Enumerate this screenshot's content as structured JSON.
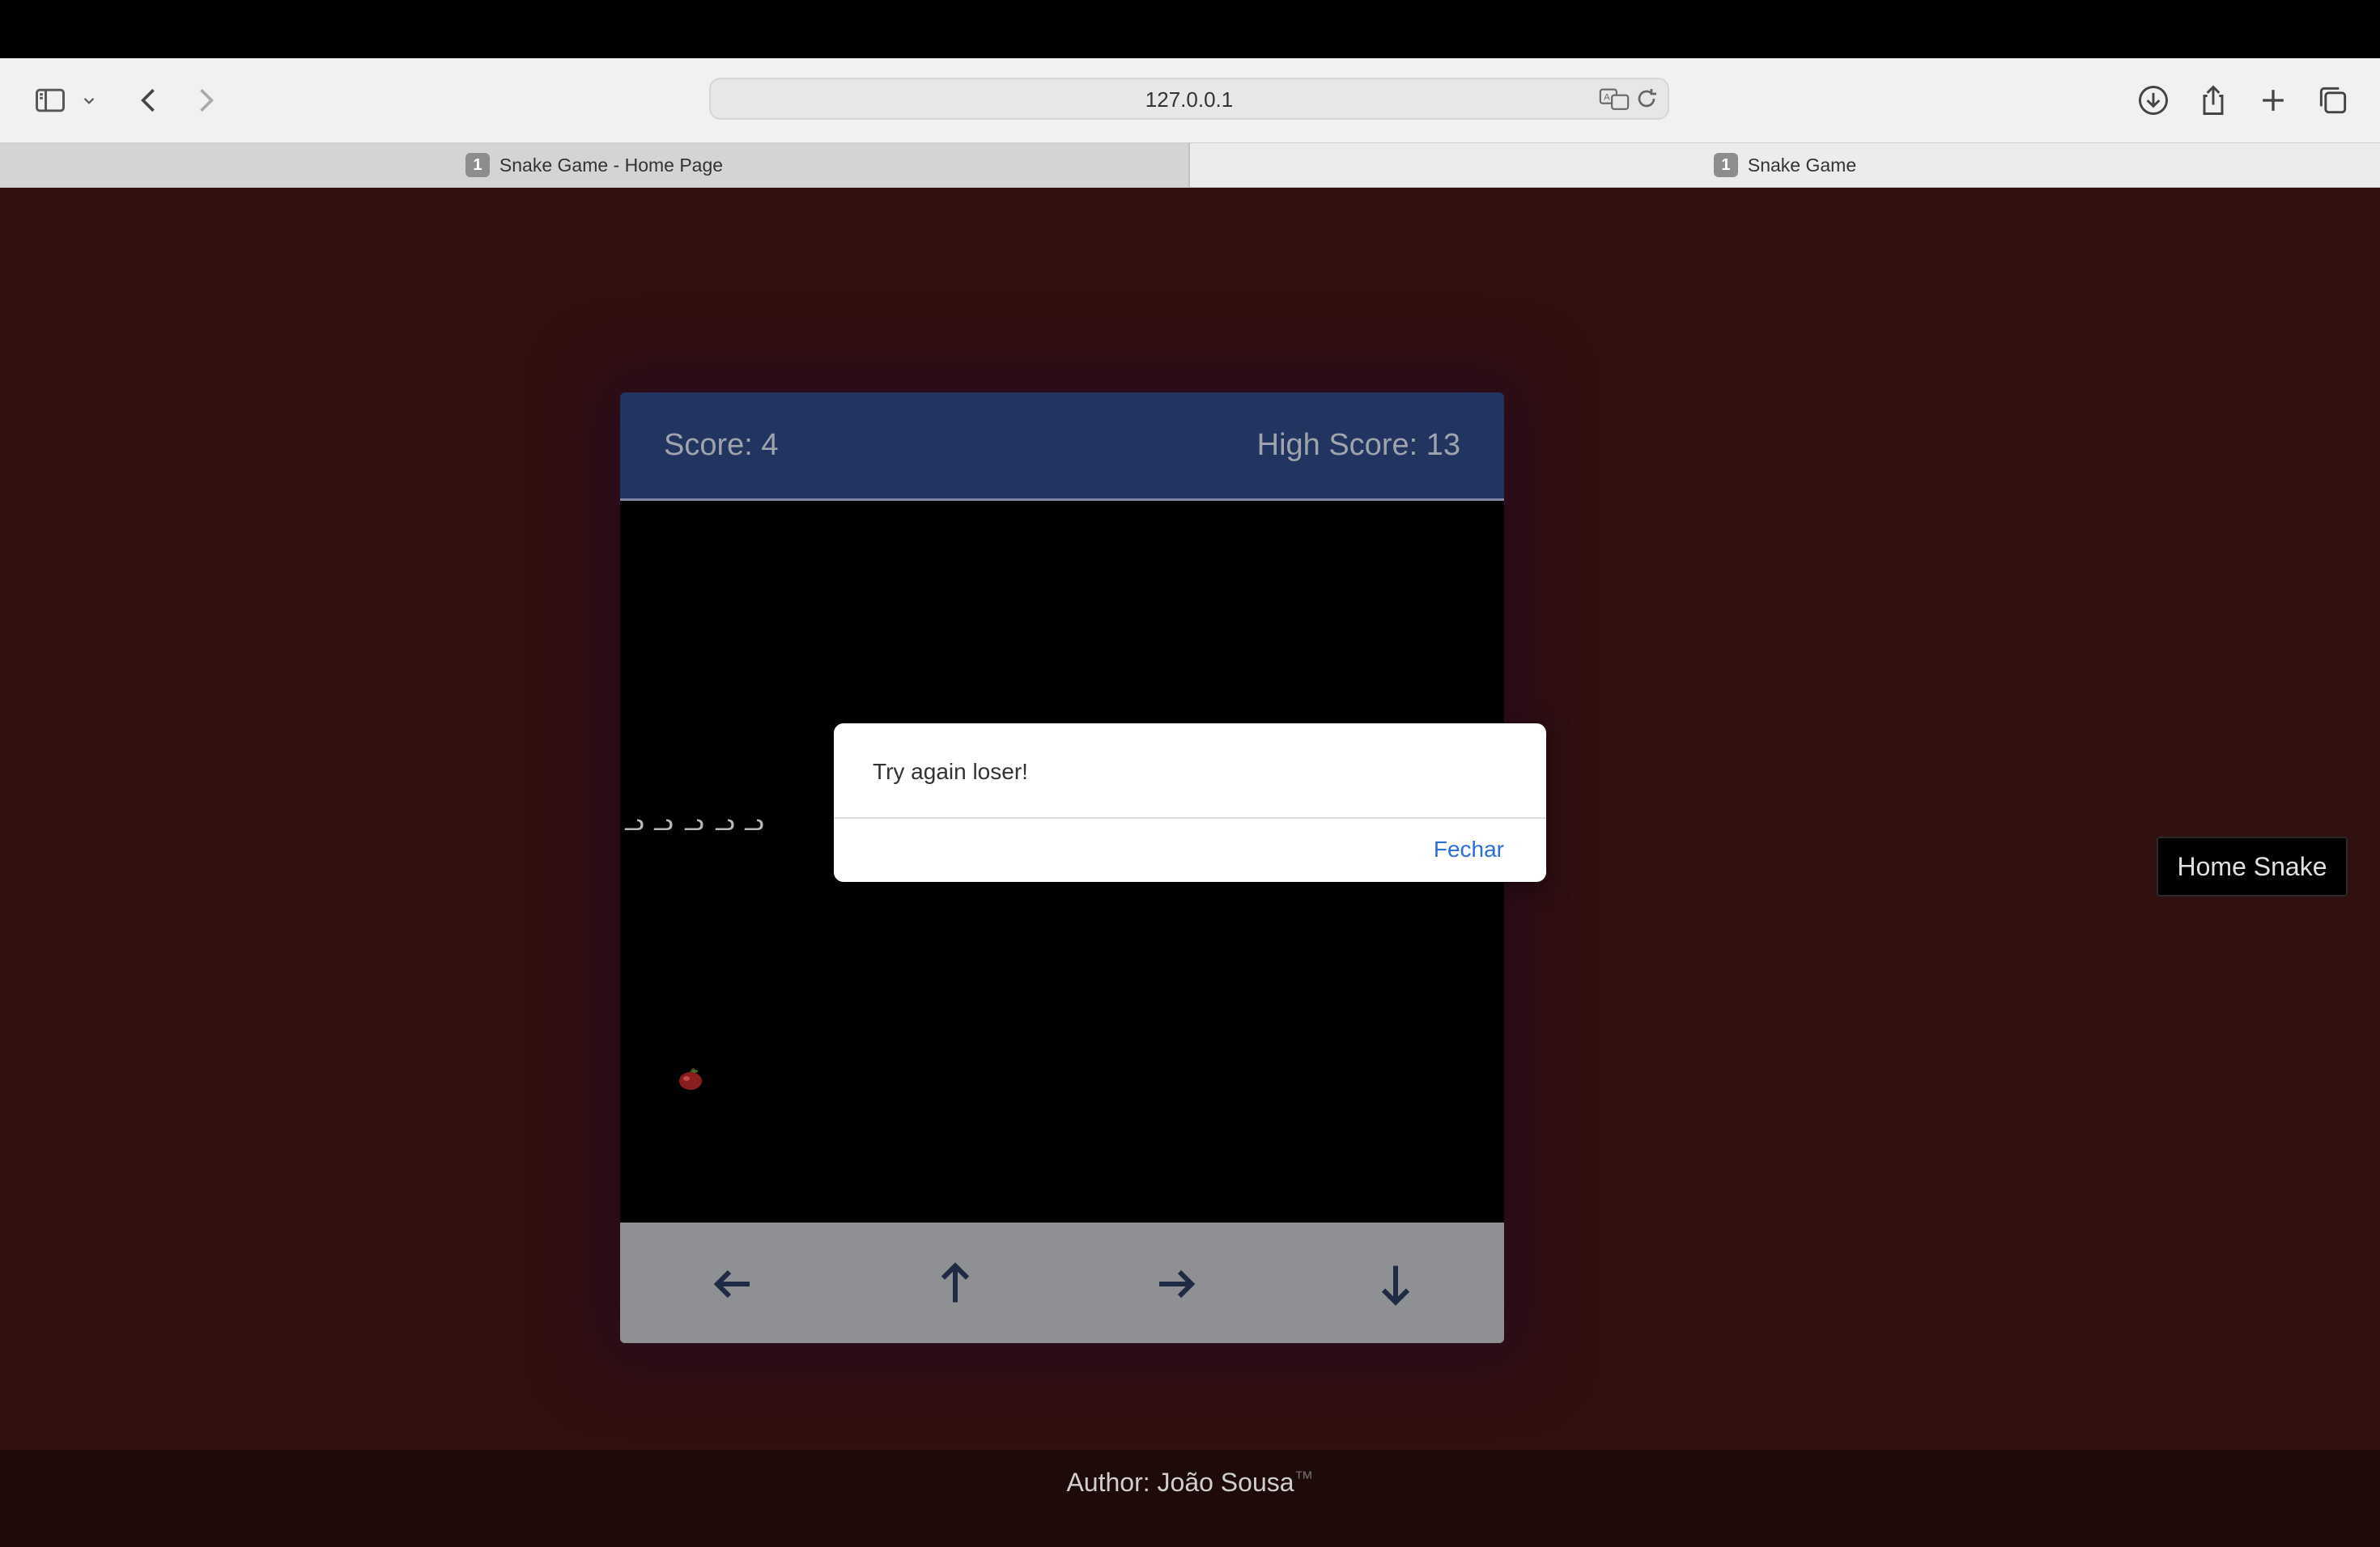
{
  "browser": {
    "url": "127.0.0.1",
    "tabs": [
      {
        "badge": "1",
        "title": "Snake Game - Home Page"
      },
      {
        "badge": "1",
        "title": "Snake Game"
      }
    ]
  },
  "game": {
    "score_label": "Score: 4",
    "high_score_label": "High Score: 13",
    "snake_segments": [
      "ᓗ",
      "ᓗ",
      "ᓗ",
      "ᓗ",
      "ᓗ"
    ],
    "food": "apple-icon",
    "controls": [
      "left-arrow-icon",
      "up-arrow-icon",
      "right-arrow-icon",
      "down-arrow-icon"
    ]
  },
  "dialog": {
    "message": "Try again loser!",
    "close_label": "Fechar"
  },
  "home_button": {
    "label": "Home Snake"
  },
  "footer": {
    "author": "Author: João Sousa",
    "tm": "™"
  },
  "colors": {
    "page_bg": "#311010",
    "score_bar": "#223460",
    "board": "#000000",
    "controls": "#8f9093",
    "link": "#2a6fd6"
  }
}
